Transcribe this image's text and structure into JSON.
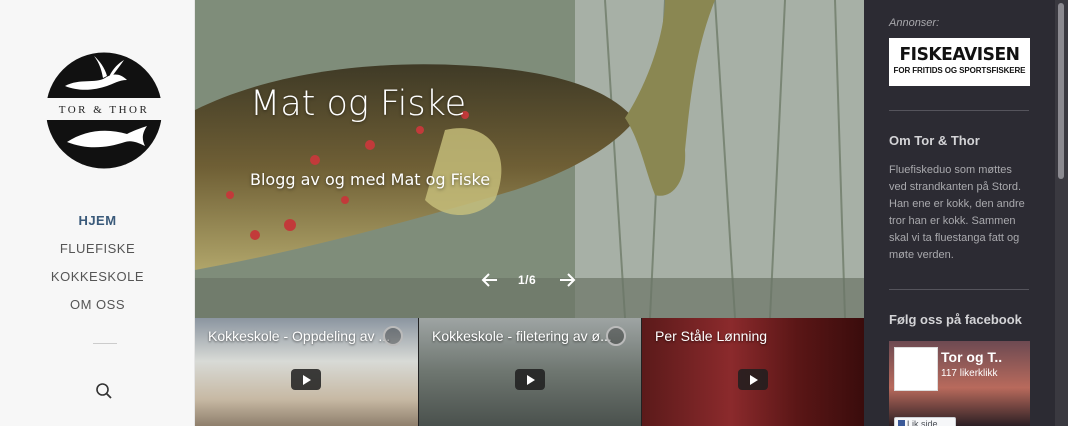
{
  "brand": {
    "logo_text": "TOR & THOR"
  },
  "nav": {
    "items": [
      {
        "label": "HJEM"
      },
      {
        "label": "FLUEFISKE"
      },
      {
        "label": "KOKKESKOLE"
      },
      {
        "label": "OM OSS"
      }
    ],
    "search_icon": "search-icon"
  },
  "hero": {
    "title": "Mat og Fiske",
    "subtitle": "Blogg av og med Mat og Fiske",
    "counter": "1/6",
    "current_slide": 1,
    "total_slides": 6,
    "prev_icon": "arrow-left-icon",
    "next_icon": "arrow-right-icon"
  },
  "videos": [
    {
      "title": "Kokkeskole - Oppdeling av ..."
    },
    {
      "title": "Kokkeskole - filetering av ø..."
    },
    {
      "title": "Per Ståle Lønning"
    }
  ],
  "right_sidebar": {
    "ad_label": "Annonser:",
    "ad": {
      "title": "FISKEAVISEN",
      "tagline": "FOR FRITIDS OG SPORTSFISKERE"
    },
    "about": {
      "heading": "Om Tor & Thor",
      "text": "Fluefiskeduo som møttes ved strandkanten på Stord. Han ene er kokk, den andre tror han er kokk. Sammen skal vi ta fluestanga fatt og møte verden."
    },
    "facebook": {
      "heading": "Følg oss på facebook",
      "page_name": "Tor og T..",
      "likes": "117 likerklikk",
      "like_button": "Lik side"
    }
  },
  "colors": {
    "right_sidebar_bg": "#2c2b33",
    "left_sidebar_bg": "#f7f7f7",
    "nav_active": "#3a5a7a"
  }
}
